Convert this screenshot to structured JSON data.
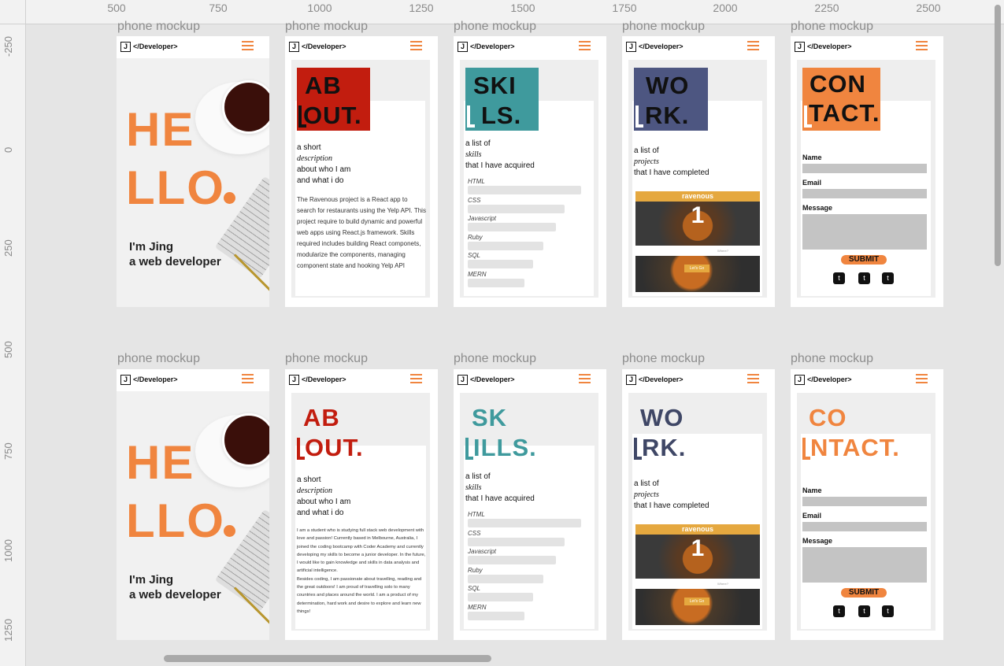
{
  "ruler": {
    "top_labels": [
      "500",
      "750",
      "1000",
      "1250",
      "1500",
      "1750",
      "2000",
      "2250",
      "2500"
    ],
    "left_labels": [
      "-250",
      "0",
      "250",
      "500",
      "750",
      "1000",
      "1250"
    ]
  },
  "mockup_label": "phone mockup",
  "nav": {
    "logo": "J",
    "brand": "</Developer>"
  },
  "hero": {
    "line1": "HE",
    "line2": "LLO",
    "intro1": "I'm Jing",
    "intro2": "a web developer"
  },
  "about": {
    "t1": "AB",
    "t2": "OUT.",
    "sub1": "a short",
    "sub2": "description",
    "sub3": "about who I am",
    "sub4": "and what i do",
    "para1": "The Ravenous project is a React app to search for restaurants using the Yelp API. This project require to build dynamic and powerful web apps using React.js framework. Skills required includes building React componets, modularize the components, managing component state and hooking Yelp API",
    "para2a": "I am a student who is studying full stack web development with love and passion! Currently based in Melbourne, Australia, I joined the coding bootcamp with Coder Academy and currently developing my skills to become a junior developer. In the future, I would like to gain knowledge and skills in data analysis and artificial intelligence.",
    "para2b": "Besides coding, I am passionate about travelling, reading and the great outdoors! I am proud of travelling solo to many countries and places around the world. I am a product of my determination, hard work and desire to explore and learn new things!"
  },
  "skills": {
    "t1a": "SKI",
    "t2a": "LS.",
    "t1b": "SK",
    "t2b": "ILLS.",
    "sub1": "a list of",
    "sub2": "skills",
    "sub3": "that I have acquired",
    "items": [
      "HTML",
      "CSS",
      "Javascript",
      "Ruby",
      "SQL",
      "MERN"
    ],
    "levels": [
      0.9,
      0.77,
      0.7,
      0.6,
      0.52,
      0.45
    ]
  },
  "work": {
    "t1": "WO",
    "t2": "RK.",
    "sub1": "a list of",
    "sub2": "projects",
    "sub3": "that I have completed",
    "project_title": "ravenous",
    "project_num": "1",
    "where": "Where?",
    "cta": "Let's Go"
  },
  "contact": {
    "t1a": "CON",
    "t2a": "TACT.",
    "t1b": "CO",
    "t2b": "NTACT.",
    "name": "Name",
    "email": "Email",
    "message": "Message",
    "submit": "SUBMIT"
  },
  "colors": {
    "orange": "#f0853f",
    "red": "#c21d0f",
    "teal": "#3f9a9d",
    "navy": "#4d5681",
    "navy_dark": "#3f4766"
  }
}
